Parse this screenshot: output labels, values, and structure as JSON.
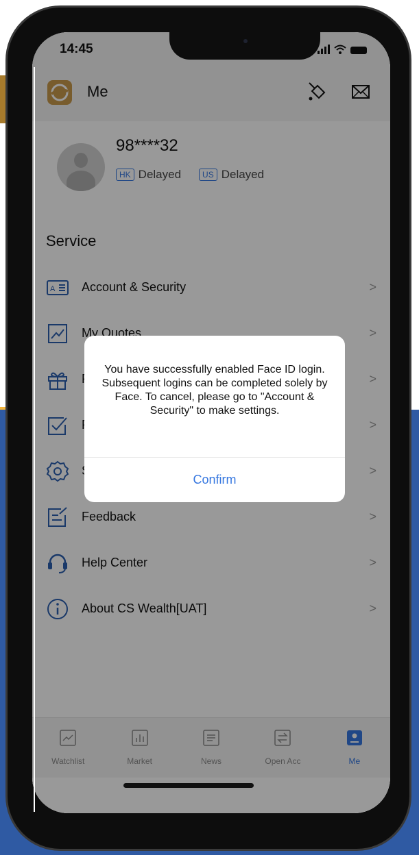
{
  "status_bar": {
    "time": "14:45"
  },
  "header": {
    "title": "Me"
  },
  "profile": {
    "user_id": "98****32",
    "markets": [
      {
        "tag": "HK",
        "status": "Delayed"
      },
      {
        "tag": "US",
        "status": "Delayed"
      }
    ]
  },
  "service": {
    "title": "Service",
    "items": [
      {
        "label": "Account & Security"
      },
      {
        "label": "My Quotes"
      },
      {
        "label": "P"
      },
      {
        "label": "P"
      },
      {
        "label": "S"
      },
      {
        "label": "Feedback"
      },
      {
        "label": "Help Center"
      },
      {
        "label": "About CS Wealth[UAT]"
      }
    ],
    "chevron": ">"
  },
  "tabs": [
    {
      "label": "Watchlist",
      "active": false
    },
    {
      "label": "Market",
      "active": false
    },
    {
      "label": "News",
      "active": false
    },
    {
      "label": "Open Acc",
      "active": false
    },
    {
      "label": "Me",
      "active": true
    }
  ],
  "dialog": {
    "message": "You have successfully enabled Face ID login. Subsequent logins can be completed solely by Face. To cancel, please go to \"Account & Security\" to make settings.",
    "confirm_label": "Confirm"
  },
  "colors": {
    "accent": "#3677e0",
    "backdrop": "#2f5aa3",
    "brand_gold": "#c99a4c"
  }
}
